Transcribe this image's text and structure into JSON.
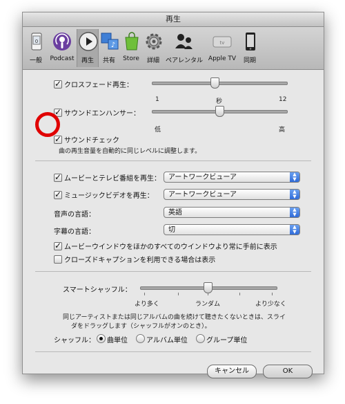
{
  "window": {
    "title": "再生"
  },
  "toolbar": {
    "items": [
      {
        "label": "一般",
        "icon": "phone-general-icon"
      },
      {
        "label": "Podcast",
        "icon": "podcast-icon"
      },
      {
        "label": "再生",
        "icon": "play-icon",
        "selected": true
      },
      {
        "label": "共有",
        "icon": "sharing-icon"
      },
      {
        "label": "Store",
        "icon": "store-bag-icon"
      },
      {
        "label": "詳細",
        "icon": "gear-icon"
      },
      {
        "label": "ペアレンタル",
        "icon": "parental-icon"
      },
      {
        "label": "Apple TV",
        "icon": "apple-tv-icon"
      },
      {
        "label": "同期",
        "icon": "sync-icon"
      }
    ]
  },
  "crossfade": {
    "label": "クロスフェード再生：",
    "checked": true,
    "value": 7,
    "min_label": "1",
    "mid_label": "秒",
    "max_label": "12"
  },
  "enhancer": {
    "label": "サウンドエンハンサー：",
    "checked": true,
    "value": 0.5,
    "low_label": "低",
    "high_label": "高"
  },
  "soundcheck": {
    "label": "サウンドチェック",
    "checked": true,
    "description": "曲の再生音量を自動的に同じレベルに調整します。"
  },
  "movies_tv": {
    "label": "ムービーとテレビ番組を再生：",
    "checked": true,
    "value": "アートワークビューア"
  },
  "music_video": {
    "label": "ミュージックビデオを再生：",
    "checked": true,
    "value": "アートワークビューア"
  },
  "audio_lang": {
    "label": "音声の言語：",
    "value": "英語"
  },
  "subtitle_lang": {
    "label": "字幕の言語：",
    "value": "切"
  },
  "movie_window": {
    "label": "ムービーウインドウをほかのすべてのウインドウより常に手前に表示",
    "checked": true
  },
  "closed_caption": {
    "label": "クローズドキャプションを利用できる場合は表示",
    "checked": false
  },
  "smart_shuffle": {
    "label": "スマートシャッフル：",
    "value": 0.5,
    "less_label": "より多く",
    "mid_label": "ランダム",
    "more_label": "より少なく",
    "description_1": "同じアーティストまたは同じアルバムの曲を続けて聴きたくないときは、スライ",
    "description_2": "ダをドラッグします（シャッフルがオンのとき）。"
  },
  "shuffle": {
    "label": "シャッフル：",
    "options": [
      "曲単位",
      "アルバム単位",
      "グループ単位"
    ],
    "selected": "曲単位"
  },
  "buttons": {
    "cancel": "キャンセル",
    "ok": "OK"
  },
  "annotation_color": "#e00000"
}
